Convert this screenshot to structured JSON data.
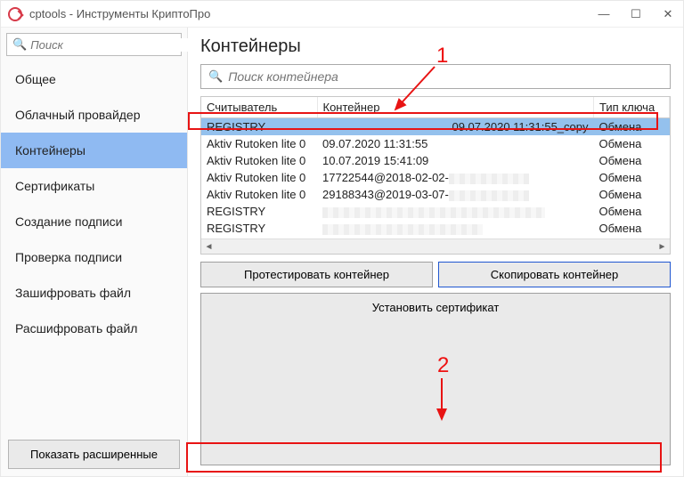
{
  "window": {
    "title": "cptools - Инструменты КриптоПро"
  },
  "sidebar": {
    "search_placeholder": "Поиск",
    "items": [
      {
        "label": "Общее"
      },
      {
        "label": "Облачный провайдер"
      },
      {
        "label": "Контейнеры",
        "selected": true
      },
      {
        "label": "Сертификаты"
      },
      {
        "label": "Создание подписи"
      },
      {
        "label": "Проверка подписи"
      },
      {
        "label": "Зашифровать файл"
      },
      {
        "label": "Расшифровать файл"
      }
    ],
    "advanced_button": "Показать расширенные"
  },
  "page": {
    "title": "Контейнеры",
    "search_placeholder": "Поиск контейнера",
    "columns": {
      "reader": "Считыватель",
      "container": "Контейнер",
      "keytype": "Тип ключа"
    },
    "rows": [
      {
        "reader": "REGISTRY",
        "container": "09.07.2020 11:31:55_copy",
        "keytype": "Обмена",
        "selected": true
      },
      {
        "reader": "Aktiv Rutoken lite 0",
        "container": "09.07.2020 11:31:55",
        "keytype": "Обмена"
      },
      {
        "reader": "Aktiv Rutoken lite 0",
        "container": "10.07.2019 15:41:09",
        "keytype": "Обмена"
      },
      {
        "reader": "Aktiv Rutoken lite 0",
        "container": "17722544@2018-02-02-",
        "keytype": "Обмена"
      },
      {
        "reader": "Aktiv Rutoken lite 0",
        "container": "29188343@2019-03-07-",
        "keytype": "Обмена"
      },
      {
        "reader": "REGISTRY",
        "container": "",
        "keytype": "Обмена"
      },
      {
        "reader": "REGISTRY",
        "container": "",
        "keytype": "Обмена"
      }
    ],
    "buttons": {
      "test": "Протестировать контейнер",
      "copy": "Скопировать контейнер",
      "install": "Установить сертификат"
    }
  },
  "annotations": {
    "label1": "1",
    "label2": "2"
  }
}
